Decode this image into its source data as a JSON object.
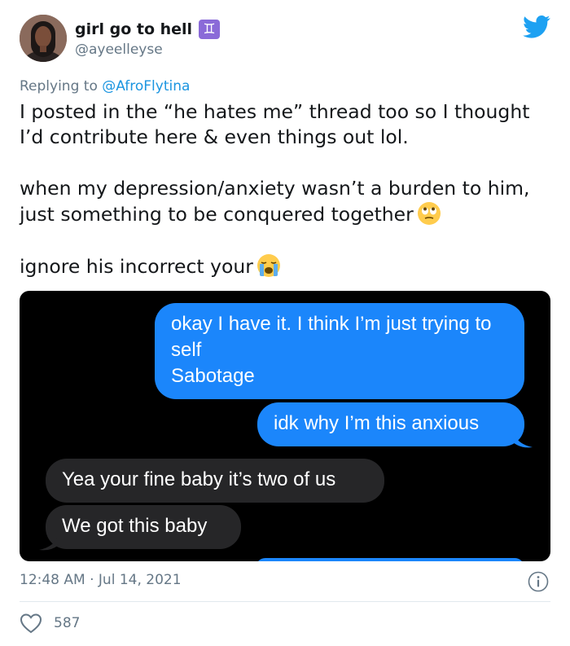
{
  "author": {
    "display_name": "girl go to hell",
    "zodiac_symbol": "♊",
    "handle": "@ayeelleyse"
  },
  "reply": {
    "prefix": "Replying to",
    "mention": "@AfroFlytina"
  },
  "tweet": {
    "paragraph_1": "I posted in the “he hates me” thread too  so I thought I’d contribute here & even things out lol.",
    "paragraph_2": "when my depression/anxiety wasn’t a burden to him, just something to be conquered together",
    "paragraph_3": "ignore his incorrect your"
  },
  "screenshot_messages": {
    "sent_1": "okay I have it. I think I’m just trying to self\nSabotage",
    "sent_2": "idk why I’m this anxious",
    "received_1": "Yea your fine baby it’s two of us",
    "received_2": "We got this baby"
  },
  "footer": {
    "timestamp": "12:48 AM · Jul 14, 2021",
    "like_count": "587"
  },
  "colors": {
    "twitter_blue": "#1da1f2",
    "imessage_blue": "#1b86fb",
    "received_gray": "#262628",
    "muted_text": "#657786"
  },
  "icons": [
    "twitter-bird-icon",
    "gemini-icon",
    "rolling-eyes-emoji",
    "crying-emoji",
    "info-icon",
    "heart-icon"
  ]
}
